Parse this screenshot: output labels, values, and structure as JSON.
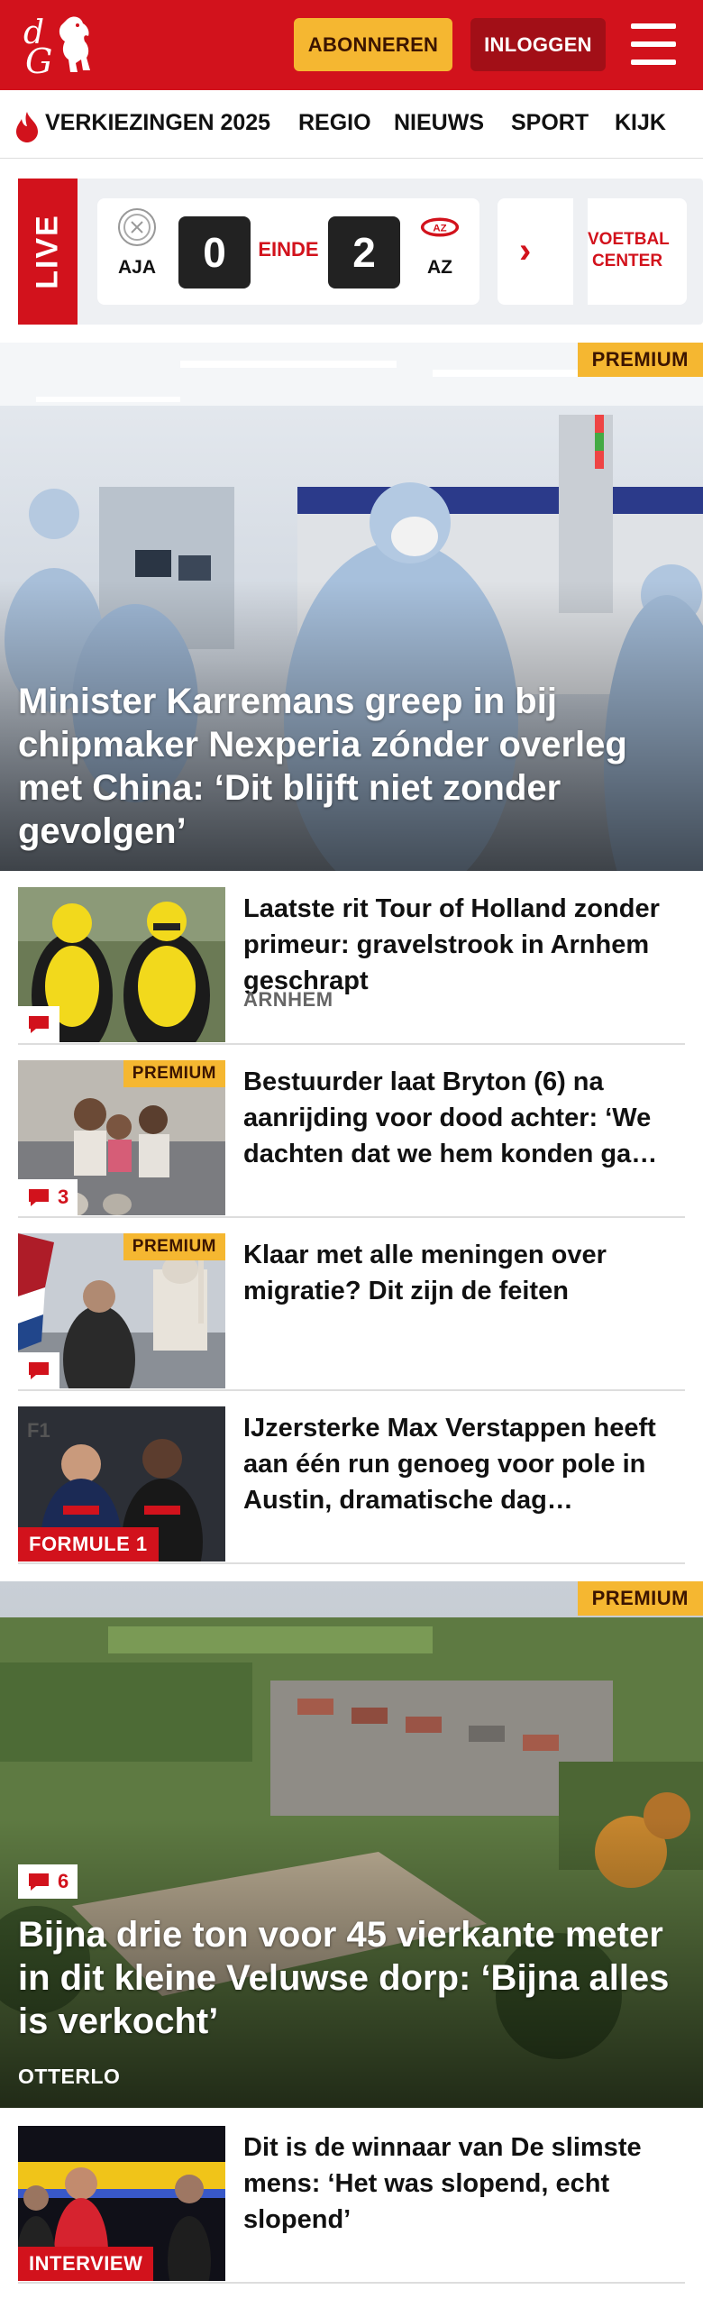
{
  "header": {
    "logo_letters": "dG",
    "subscribe_label": "ABONNEREN",
    "login_label": "INLOGGEN",
    "menu_icon": "hamburger-icon"
  },
  "nav": {
    "items": [
      {
        "label": "VERKIEZINGEN 2025",
        "icon": "flame-icon"
      },
      {
        "label": "REGIO"
      },
      {
        "label": "NIEUWS"
      },
      {
        "label": "SPORT"
      },
      {
        "label": "KIJK"
      }
    ]
  },
  "live": {
    "label": "LIVE",
    "match": {
      "home": "AJA",
      "home_score": "0",
      "status": "EINDE",
      "away_score": "2",
      "away": "AZ"
    },
    "voetbalcenter_label": "VOETBAL CENTER"
  },
  "hero": {
    "badge": "PREMIUM",
    "title": "Minister Karremans greep in bij chipmaker Nexperia zónder overleg met China: ‘Dit blijft niet zonder gevolgen’"
  },
  "articles": [
    {
      "title": "Laatste rit Tour of Holland zonder primeur: gravelstrook in Arnhem geschrapt",
      "location": "ARNHEM",
      "comments": "",
      "premium": ""
    },
    {
      "title": "Bestuurder laat Bryton (6) na aanrijding voor dood achter: ‘We dachten dat we hem konden ga…",
      "location": "",
      "comments": "3",
      "premium": "PREMIUM"
    },
    {
      "title": "Klaar met alle meningen over migratie? Dit zijn de feiten",
      "location": "",
      "comments": "",
      "premium": "PREMIUM"
    },
    {
      "title": "IJzersterke Max Verstappen heeft aan één run genoeg voor pole in Austin, dramatische dag…",
      "location": "",
      "tag": "FORMULE 1",
      "premium": ""
    }
  ],
  "hero2": {
    "badge": "PREMIUM",
    "comments": "6",
    "title": "Bijna drie ton voor 45 vierkante meter in dit kleine Veluwse dorp: ‘Bijna alles is verkocht’",
    "location": "OTTERLO"
  },
  "article_last": {
    "title": "Dit is de winnaar van De slimste mens: ‘Het was slopend, echt slopend’",
    "tag": "INTERVIEW"
  },
  "colors": {
    "brand_red": "#d2121c",
    "premium_yellow": "#f5b731",
    "login_dark_red": "#a20f17"
  }
}
